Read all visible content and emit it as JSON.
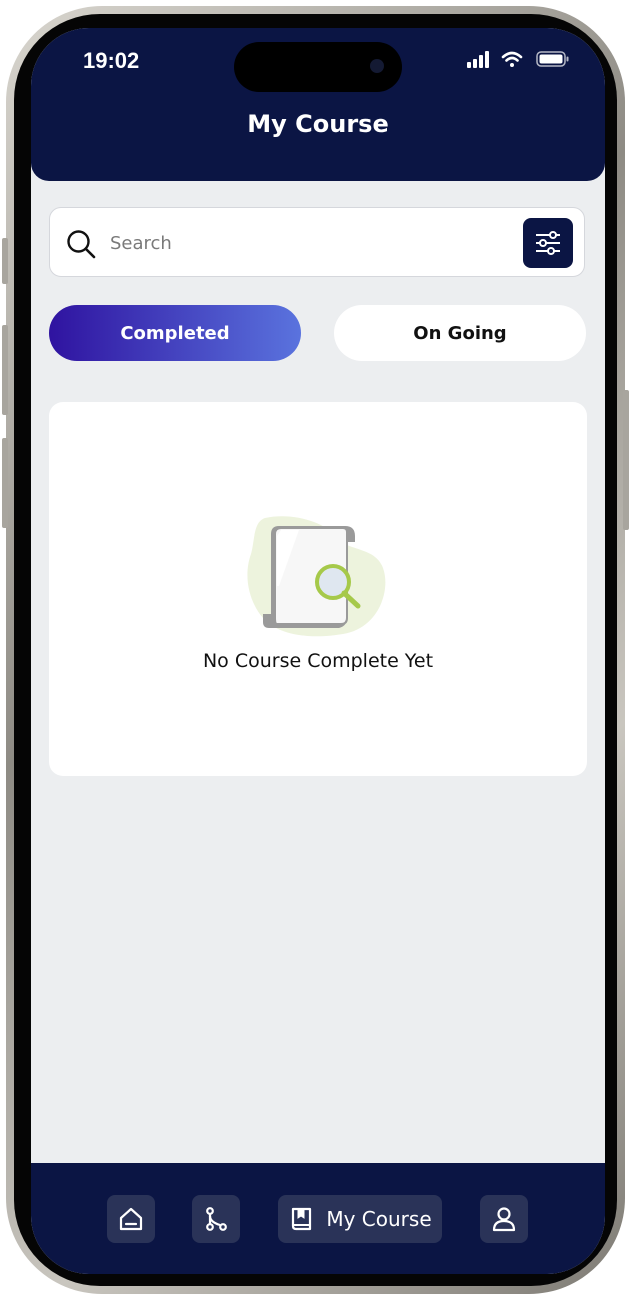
{
  "status_bar": {
    "time": "19:02"
  },
  "header": {
    "title": "My Course"
  },
  "search": {
    "placeholder": "Search"
  },
  "tabs": [
    {
      "label": "Completed",
      "active": true
    },
    {
      "label": "On Going",
      "active": false
    }
  ],
  "empty_state": {
    "message": "No Course Complete Yet",
    "icon": "document-search-illustration"
  },
  "bottom_nav": [
    {
      "icon": "home-icon",
      "label": ""
    },
    {
      "icon": "path-icon",
      "label": ""
    },
    {
      "icon": "book-icon",
      "label": "My Course",
      "active": true
    },
    {
      "icon": "profile-icon",
      "label": ""
    }
  ],
  "colors": {
    "primary": "#0b1544",
    "accent_start": "#2f13a0",
    "accent_end": "#5a73de",
    "background": "#eceef0"
  }
}
